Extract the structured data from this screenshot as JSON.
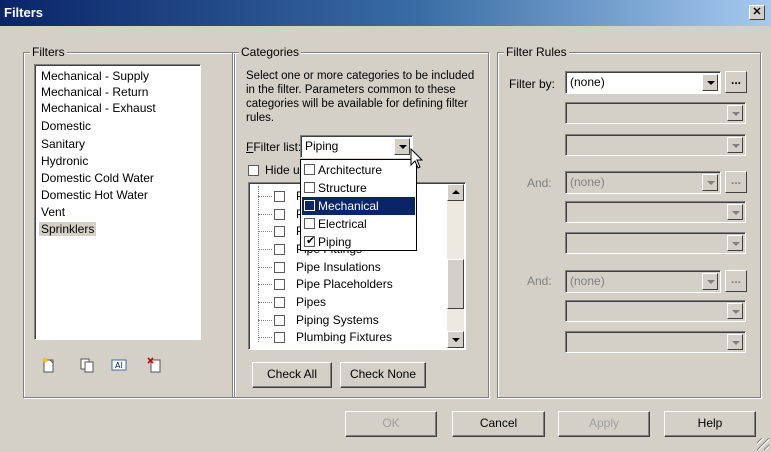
{
  "window": {
    "title": "Filters"
  },
  "filters_panel": {
    "legend": "Filters",
    "items": [
      "Mechanical - Supply",
      "Mechanical - Return",
      "Mechanical - Exhaust",
      "Domestic",
      "Sanitary",
      "Hydronic",
      "Domestic Cold Water",
      "Domestic Hot Water",
      "Vent",
      "Sprinklers"
    ],
    "selected": "Sprinklers",
    "icons": [
      "new-filter-icon",
      "duplicate-filter-icon",
      "rename-filter-icon",
      "delete-filter-icon"
    ]
  },
  "categories_panel": {
    "legend": "Categories",
    "description": "Select one or more categories to be included in the filter.  Parameters common to these categories will be available for defining filter rules.",
    "filter_list_label": "Filter list:",
    "filter_list_value": "Piping",
    "hide_prefix": "Hide u",
    "tree_items": [
      "Pipe Insulations",
      "Pipe Placeholders",
      "Pipes",
      "Piping Systems",
      "Plumbing Fixtures"
    ],
    "tree_partial": [
      "P",
      "P",
      "P",
      "Pipe Fittings"
    ],
    "check_all": "Check All",
    "check_none": "Check None",
    "dropdown_options": [
      {
        "label": "Architecture",
        "checked": false
      },
      {
        "label": "Structure",
        "checked": false
      },
      {
        "label": "Mechanical",
        "checked": false
      },
      {
        "label": "Electrical",
        "checked": false
      },
      {
        "label": "Piping",
        "checked": true
      }
    ],
    "dropdown_highlighted": "Mechanical"
  },
  "rules_panel": {
    "legend": "Filter Rules",
    "filter_by_label": "Filter by:",
    "filter_by_value": "(none)",
    "and_label": "And:",
    "and1_value": "(none)",
    "and2_value": "(none)",
    "more_label": "..."
  },
  "footer": {
    "ok": "OK",
    "cancel": "Cancel",
    "apply": "Apply",
    "help": "Help"
  },
  "colors": {
    "dialog_bg": "#d4d0c8",
    "title_dark": "#0a246a",
    "highlight": "#0a246a"
  }
}
